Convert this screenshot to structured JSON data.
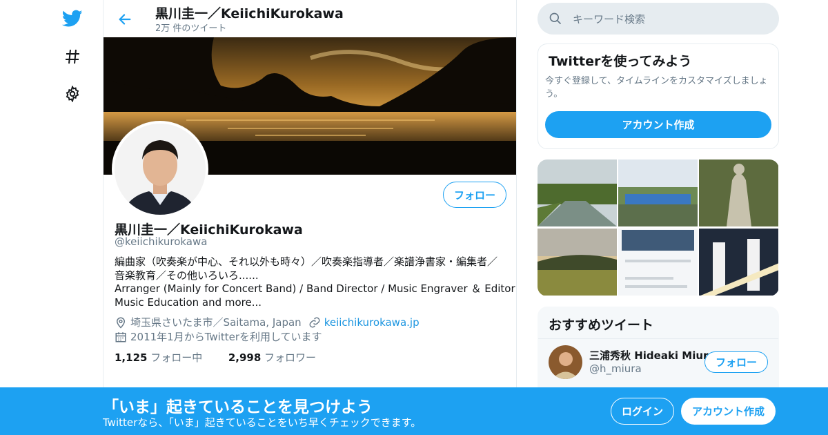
{
  "colors": {
    "accent": "#1da1f2",
    "text": "#14171a",
    "muted": "#657786",
    "link": "#1b95e0"
  },
  "nav": {
    "items": [
      {
        "icon": "twitter-bird-icon"
      },
      {
        "icon": "hashtag-icon"
      },
      {
        "icon": "gear-icon"
      }
    ]
  },
  "header": {
    "title": "黒川圭一／KeiichiKurokawa",
    "tweet_count": "2万 件のツイート"
  },
  "profile": {
    "follow_label": "フォロー",
    "name": "黒川圭一／KeiichiKurokawa",
    "handle": "@keiichikurokawa",
    "bio_lines": [
      "編曲家（吹奏楽が中心、それ以外も時々）／吹奏楽指導者／楽譜浄書家・編集者／",
      "音楽教育／その他いろいろ......",
      "Arranger (Mainly for Concert Band) / Band Director / Music Engraver ＆ Editor /",
      "Music Education and more..."
    ],
    "location": "埼玉県さいたま市／Saitama, Japan",
    "website": "keiichikurokawa.jp",
    "joined": "2011年1月からTwitterを利用しています",
    "following_count": "1,125",
    "following_label": "フォロー中",
    "followers_count": "2,998",
    "followers_label": "フォロワー"
  },
  "search": {
    "placeholder": "キーワード検索"
  },
  "signup_card": {
    "title": "Twitterを使ってみよう",
    "text": "今すぐ登録して、タイムラインをカスタマイズしましょう。",
    "button": "アカウント作成"
  },
  "recommended": {
    "heading": "おすすめツイート",
    "user_name": "三浦秀秋 Hideaki Miura",
    "user_handle": "@h_miura",
    "follow_label": "フォロー"
  },
  "bottom_bar": {
    "title": "「いま」起きていることを見つけよう",
    "subtitle": "Twitterなら、「いま」起きていることをいち早くチェックできます。",
    "login": "ログイン",
    "signup": "アカウント作成"
  }
}
